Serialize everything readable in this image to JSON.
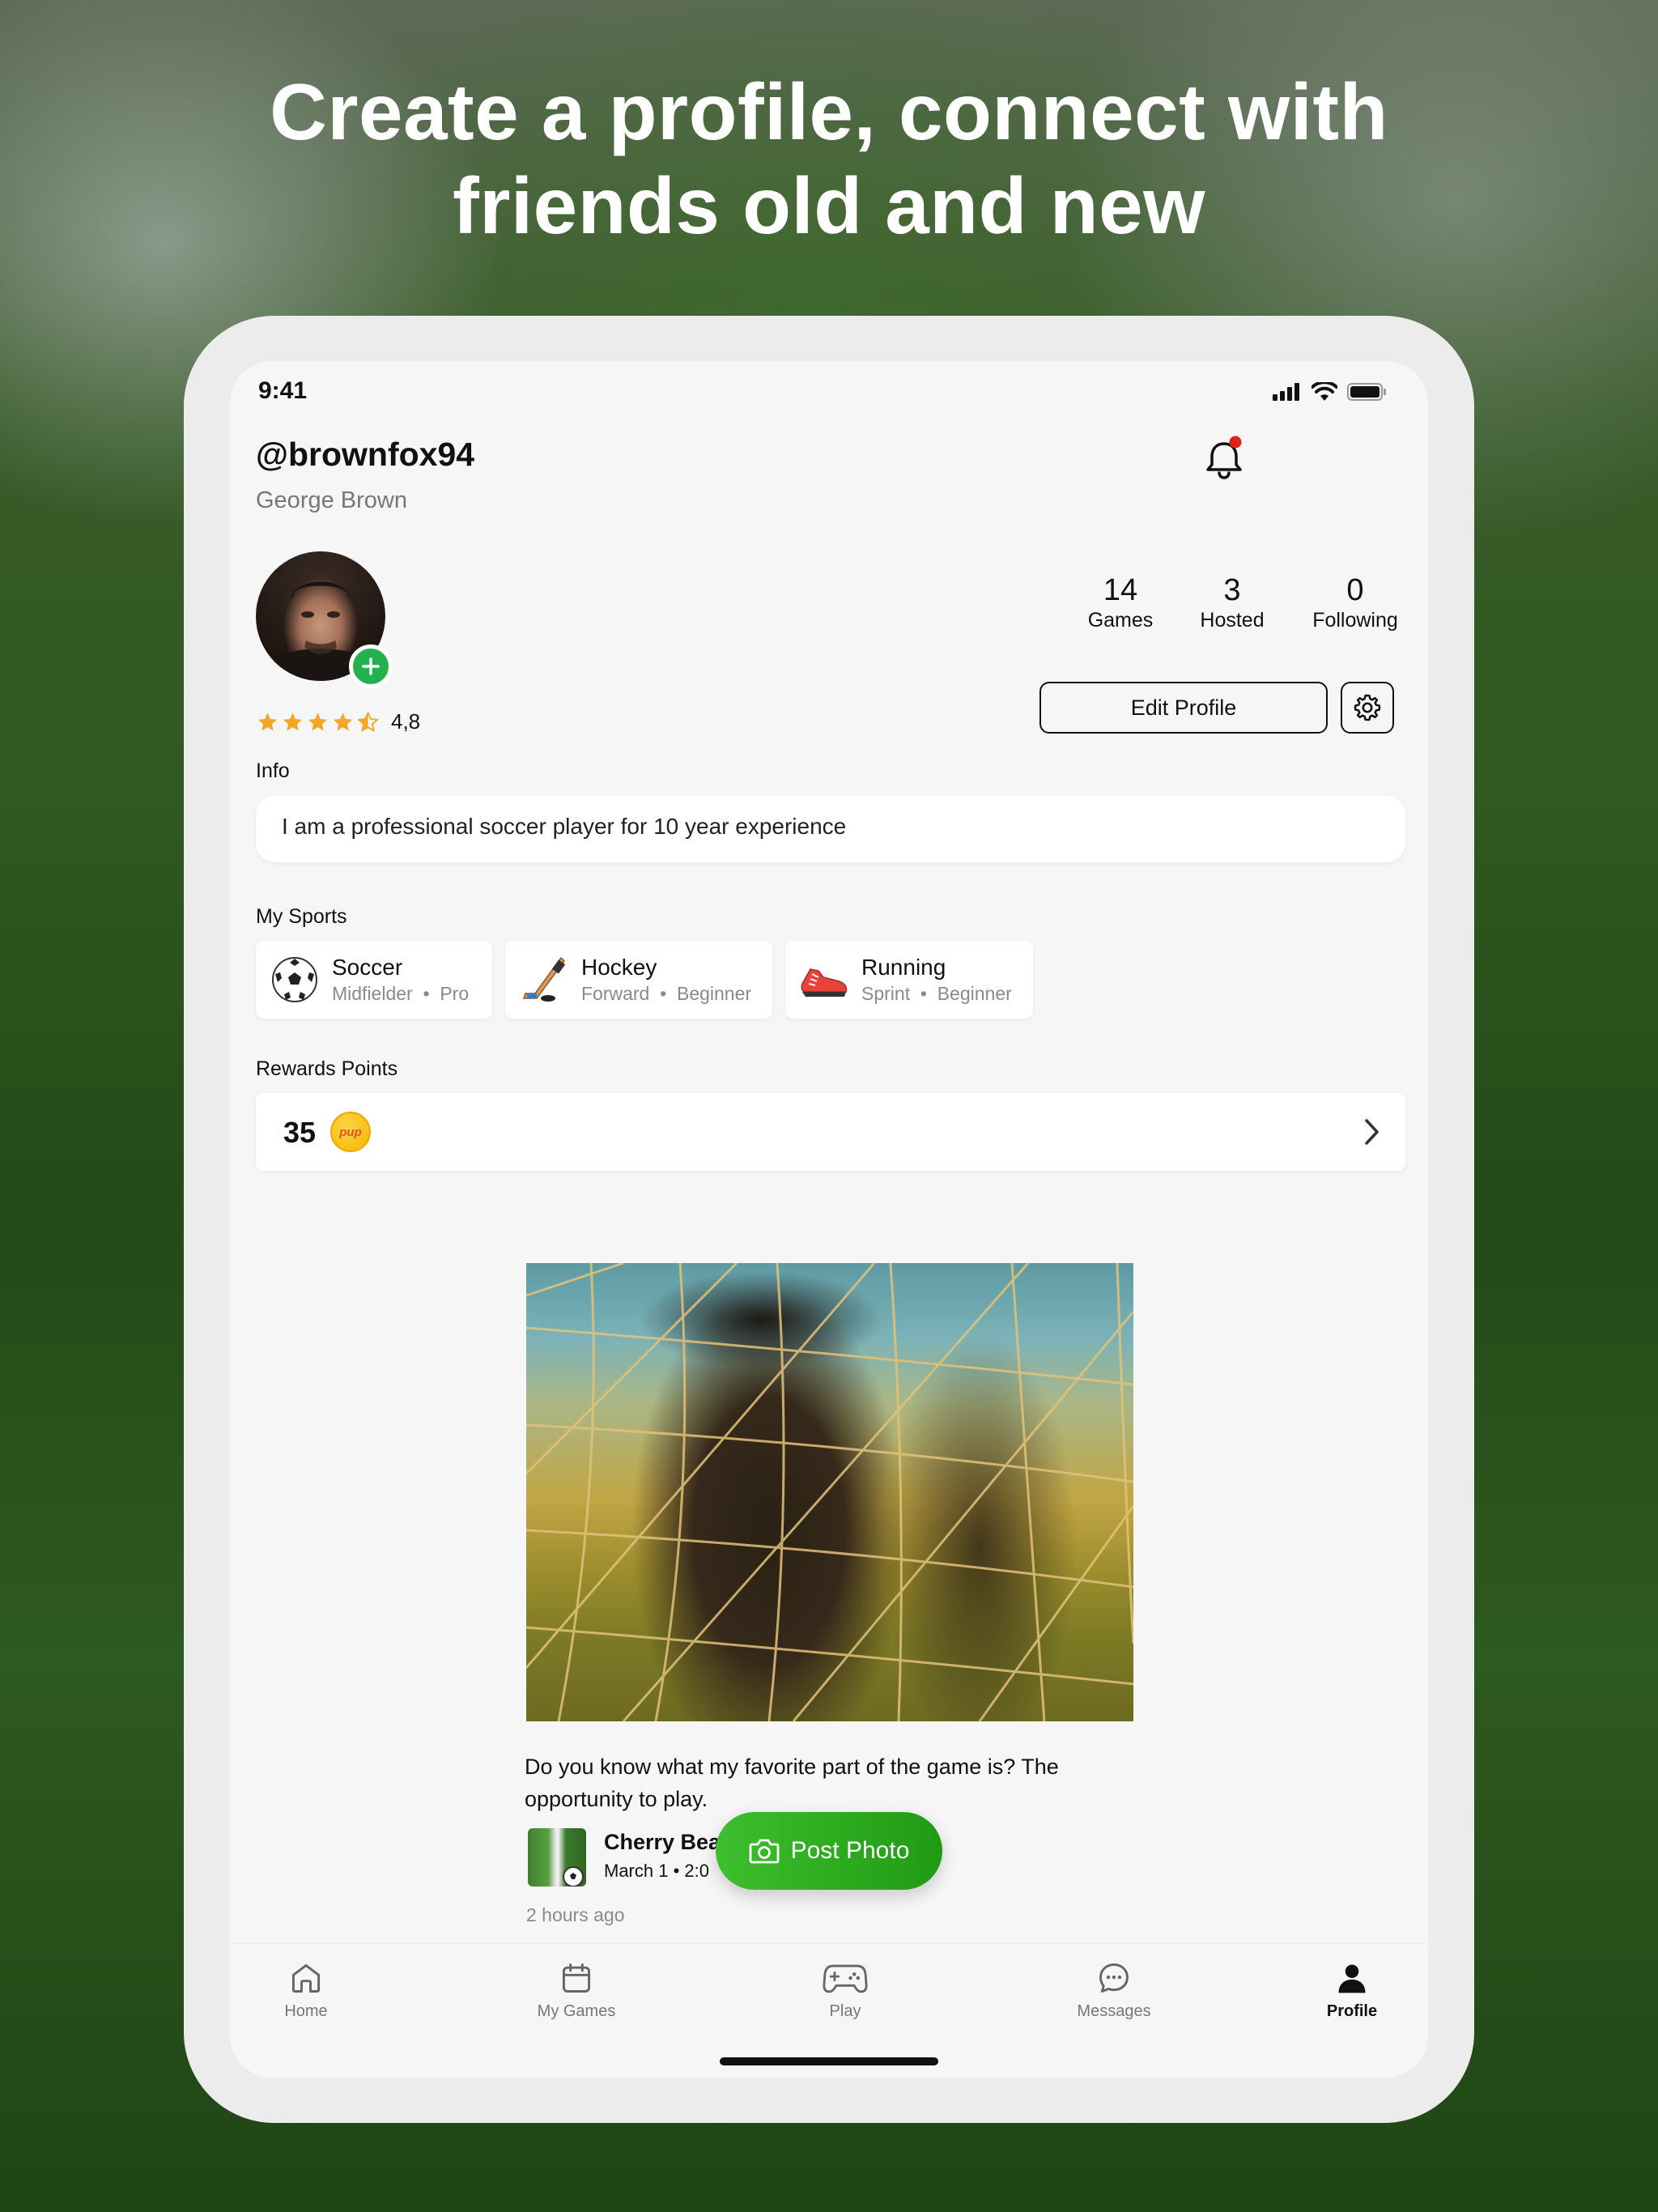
{
  "headline": {
    "line1": "Create a profile, connect with",
    "line2": "friends old and new"
  },
  "status_bar": {
    "time": "9:41"
  },
  "profile": {
    "username": "@brownfox94",
    "full_name": "George Brown",
    "rating": "4,8",
    "rating_stars": 4.5
  },
  "stats": [
    {
      "value": "14",
      "label": "Games"
    },
    {
      "value": "3",
      "label": "Hosted"
    },
    {
      "value": "0",
      "label": "Following"
    }
  ],
  "actions": {
    "edit_profile": "Edit Profile"
  },
  "info": {
    "label": "Info",
    "text": "I am a professional soccer player for 10 year experience"
  },
  "sports": {
    "label": "My Sports",
    "items": [
      {
        "name": "Soccer",
        "position": "Midfielder",
        "level": "Pro",
        "icon": "soccer-ball-icon"
      },
      {
        "name": "Hockey",
        "position": "Forward",
        "level": "Beginner",
        "icon": "hockey-stick-icon"
      },
      {
        "name": "Running",
        "position": "Sprint",
        "level": "Beginner",
        "icon": "running-shoe-icon"
      }
    ]
  },
  "rewards": {
    "label": "Rewards Points",
    "points": "35",
    "coin_text": "pup"
  },
  "post": {
    "caption": "Do you know what my favorite part of the game is? The opportunity to play.",
    "tag_name": "Cherry Bea",
    "tag_meta": "March 1  •  2:0",
    "time_ago": "2 hours ago"
  },
  "fab": {
    "label": "Post Photo"
  },
  "tabs": [
    {
      "label": "Home",
      "icon": "home-icon"
    },
    {
      "label": "My Games",
      "icon": "calendar-icon"
    },
    {
      "label": "Play",
      "icon": "gamepad-icon"
    },
    {
      "label": "Messages",
      "icon": "chat-bubble-icon"
    },
    {
      "label": "Profile",
      "icon": "person-icon",
      "active": true
    }
  ],
  "colors": {
    "accent_green": "#22b14c",
    "notification_red": "#e0201b",
    "star_gold": "#f5a623"
  }
}
